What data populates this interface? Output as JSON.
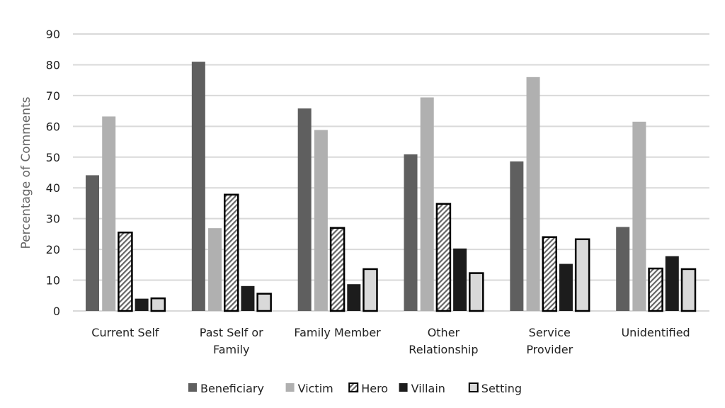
{
  "chart_data": {
    "type": "bar",
    "title": "",
    "xlabel": "",
    "ylabel": "Percentage of Comments",
    "ylim": [
      0,
      90
    ],
    "yticks": [
      0,
      10,
      20,
      30,
      40,
      50,
      60,
      70,
      80,
      90
    ],
    "grid": true,
    "legend_position": "bottom",
    "categories": [
      [
        "Current Self"
      ],
      [
        "Past Self or",
        "Family"
      ],
      [
        "Family Member"
      ],
      [
        "Other",
        "Relationship"
      ],
      [
        "Service",
        "Provider"
      ],
      [
        "Unidentified"
      ]
    ],
    "series": [
      {
        "name": "Beneficiary",
        "color": "#5f5f5f",
        "pattern": "solid",
        "values": [
          44.1,
          81.0,
          65.8,
          50.9,
          48.6,
          27.3
        ]
      },
      {
        "name": "Victim",
        "color": "#b0b0b0",
        "pattern": "solid",
        "values": [
          63.2,
          26.9,
          58.8,
          69.4,
          76.0,
          61.5
        ]
      },
      {
        "name": "Hero",
        "color": "#ffffff",
        "pattern": "diagonal-hatch",
        "values": [
          25.5,
          37.8,
          27.0,
          34.8,
          24.0,
          13.8
        ]
      },
      {
        "name": "Villain",
        "color": "#1c1c1c",
        "pattern": "solid",
        "values": [
          4.0,
          8.1,
          8.7,
          20.3,
          15.3,
          17.8
        ]
      },
      {
        "name": "Setting",
        "color": "#d9d9d9",
        "pattern": "outlined",
        "values": [
          4.1,
          5.6,
          13.6,
          12.3,
          23.3,
          13.6
        ]
      }
    ]
  }
}
